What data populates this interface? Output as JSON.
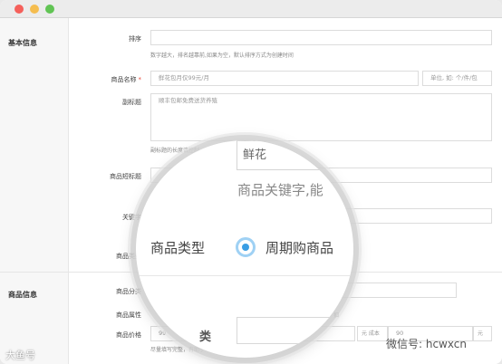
{
  "window": {
    "controls": [
      "close",
      "minimize",
      "maximize"
    ]
  },
  "sections": {
    "basic": "基本信息",
    "product": "商品信息"
  },
  "fields": {
    "sort": {
      "label": "排序",
      "value": "",
      "hint": "数字越大，排名越靠前,如果为空，默认排序方式为创建时间"
    },
    "name": {
      "label": "商品名称",
      "required": "*",
      "placeholder": "鲜花包月仅99元/月",
      "unit_placeholder": "单位, 如: 个/件/包"
    },
    "subtitle": {
      "label": "副标题",
      "placeholder": "顺丰包邮免费送货养殖",
      "hint": "副标题的长度请控制"
    },
    "short_title": {
      "label": "商品短标题"
    },
    "keywords": {
      "label": "关键字"
    },
    "type": {
      "label": "商品类型"
    },
    "category": {
      "label": "商品分类"
    },
    "attributes": {
      "label": "商品属性",
      "trailing": "扣"
    },
    "price": {
      "label": "商品价格",
      "value": "99",
      "addon1": "元 成本",
      "addon2": "90",
      "addon3": "元",
      "hint": "尽量填写完整，有助于"
    }
  },
  "magnifier": {
    "input_text": "鲜花",
    "keyword_text": "商品关键字,能",
    "type_label": "商品类型",
    "option_label": "周期购商品",
    "bottom_char": "类"
  },
  "watermarks": {
    "left": "大鱼号",
    "right": "微信号: hcwxcn"
  }
}
